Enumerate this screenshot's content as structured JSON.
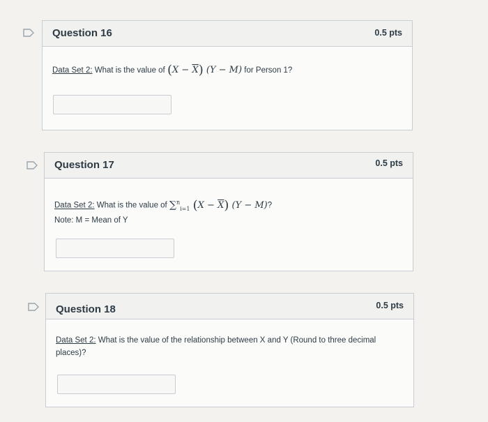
{
  "questions": [
    {
      "title": "Question 16",
      "points": "0.5 pts",
      "dataset_label": "Data Set 2:",
      "prompt_before": "What is the value of",
      "prompt_after": "for Person 1?",
      "math_x": "X",
      "math_xbar": "X",
      "math_y": "(Y − M)",
      "answer_value": ""
    },
    {
      "title": "Question 17",
      "points": "0.5 pts",
      "dataset_label": "Data Set 2:",
      "prompt_before": "What is the value of",
      "prompt_after": "?",
      "math_x": "X",
      "math_xbar": "X",
      "math_y": "(Y − M)",
      "sum_sup": "n",
      "sum_sub": "i=1",
      "note": "Note: M = Mean of Y",
      "answer_value": ""
    },
    {
      "title": "Question 18",
      "points": "0.5 pts",
      "dataset_label": "Data Set 2:",
      "prompt": "What is the value of the relationship between X and Y (Round to three decimal places)?",
      "answer_value": ""
    }
  ],
  "icons": {
    "flag": "flag-icon"
  }
}
